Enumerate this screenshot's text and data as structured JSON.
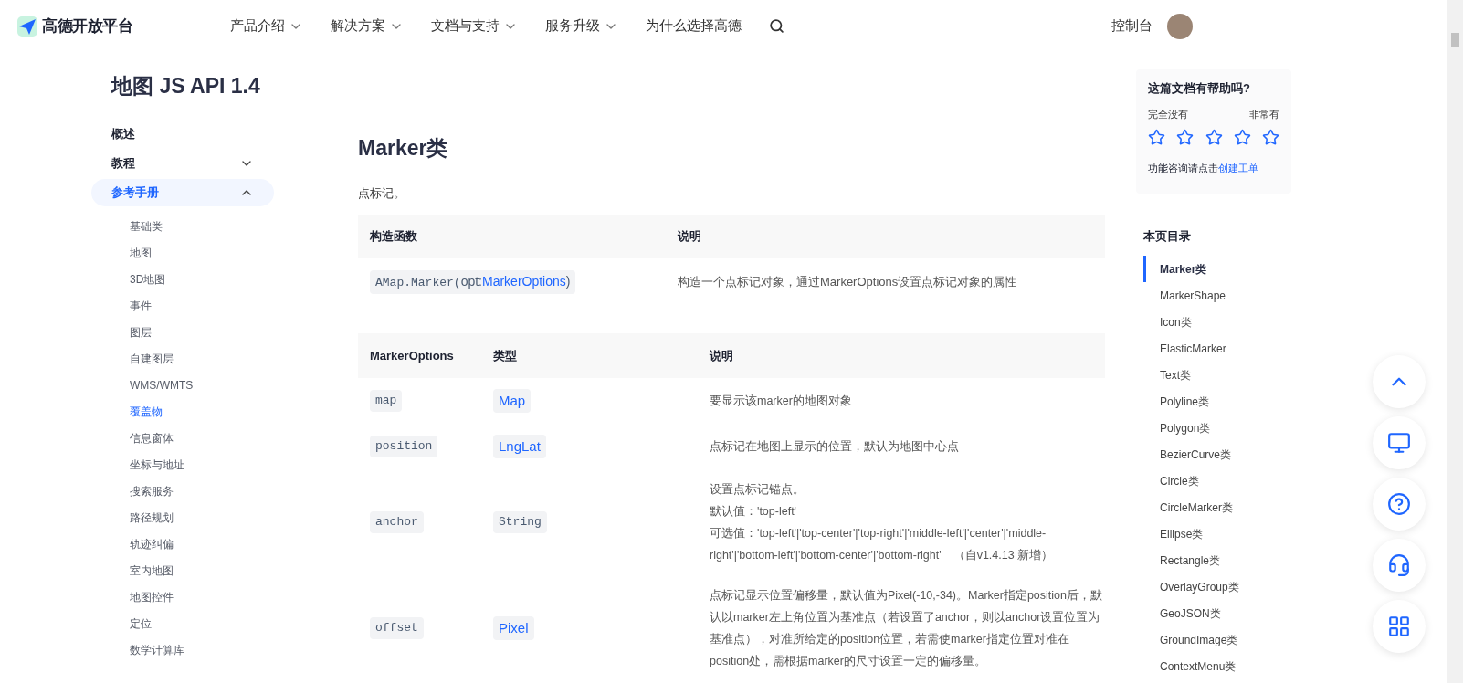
{
  "header": {
    "logo_text": "高德开放平台",
    "nav": [
      {
        "label": "产品介绍",
        "has_dropdown": true
      },
      {
        "label": "解决方案",
        "has_dropdown": true
      },
      {
        "label": "文档与支持",
        "has_dropdown": true
      },
      {
        "label": "服务升级",
        "has_dropdown": true
      },
      {
        "label": "为什么选择高德",
        "has_dropdown": false
      }
    ],
    "console_link": "控制台"
  },
  "sidebar": {
    "title": "地图 JS API 1.4",
    "items": [
      {
        "label": "概述",
        "has_children": false,
        "expanded": false
      },
      {
        "label": "教程",
        "has_children": true,
        "expanded": false
      },
      {
        "label": "参考手册",
        "has_children": true,
        "expanded": true,
        "children": [
          {
            "label": "基础类",
            "selected": false
          },
          {
            "label": "地图",
            "selected": false
          },
          {
            "label": "3D地图",
            "selected": false
          },
          {
            "label": "事件",
            "selected": false
          },
          {
            "label": "图层",
            "selected": false
          },
          {
            "label": "自建图层",
            "selected": false
          },
          {
            "label": "WMS/WMTS",
            "selected": false
          },
          {
            "label": "覆盖物",
            "selected": true
          },
          {
            "label": "信息窗体",
            "selected": false
          },
          {
            "label": "坐标与地址",
            "selected": false
          },
          {
            "label": "搜索服务",
            "selected": false
          },
          {
            "label": "路径规划",
            "selected": false
          },
          {
            "label": "轨迹纠偏",
            "selected": false
          },
          {
            "label": "室内地图",
            "selected": false
          },
          {
            "label": "地图控件",
            "selected": false
          },
          {
            "label": "定位",
            "selected": false
          },
          {
            "label": "数学计算库",
            "selected": false
          }
        ]
      }
    ]
  },
  "content": {
    "heading": "Marker类",
    "intro": "点标记。",
    "constructor_table": {
      "columns": [
        "构造函数",
        "说明"
      ],
      "rows": [
        {
          "signature": [
            {
              "text": "AMap.Marker(",
              "kind": "code"
            },
            {
              "text": "opt:",
              "kind": "plain"
            },
            {
              "text": "MarkerOptions",
              "kind": "link"
            },
            {
              "text": ")",
              "kind": "plain"
            }
          ],
          "description": "构造一个点标记对象，通过MarkerOptions设置点标记对象的属性"
        }
      ]
    },
    "options_table": {
      "columns": [
        "MarkerOptions",
        "类型",
        "说明"
      ],
      "rows": [
        {
          "name": "map",
          "type": {
            "text": "Map",
            "kind": "link"
          },
          "description": [
            "要显示该marker的地图对象"
          ]
        },
        {
          "name": "position",
          "type": {
            "text": "LngLat",
            "kind": "link"
          },
          "description": [
            "点标记在地图上显示的位置，默认为地图中心点"
          ]
        },
        {
          "name": "anchor",
          "type": {
            "text": "String",
            "kind": "code"
          },
          "description": [
            "设置点标记锚点。",
            "默认值：'top-left'",
            "可选值：'top-left'|'top-center'|'top-right'|'middle-left'|'center'|'middle-right'|'bottom-left'|'bottom-center'|'bottom-right'　（自v1.4.13 新增）"
          ]
        },
        {
          "name": "offset",
          "type": {
            "text": "Pixel",
            "kind": "link"
          },
          "description": [
            "点标记显示位置偏移量，默认值为Pixel(-10,-34)。Marker指定position后，默认以marker左上角位置为基准点（若设置了anchor，则以anchor设置位置为基准点），对准所给定的position位置，若需使marker指定位置对准在position处，需根据marker的尺寸设置一定的偏移量。"
          ]
        }
      ]
    }
  },
  "feedback": {
    "title": "这篇文档有帮助吗?",
    "low_label": "完全没有",
    "high_label": "非常有",
    "stars": 0,
    "footer_text": "功能咨询请点击",
    "footer_link": "创建工单"
  },
  "toc": {
    "title": "本页目录",
    "items": [
      {
        "label": "Marker类",
        "selected": true
      },
      {
        "label": "MarkerShape",
        "selected": false
      },
      {
        "label": "Icon类",
        "selected": false
      },
      {
        "label": "ElasticMarker",
        "selected": false
      },
      {
        "label": "Text类",
        "selected": false
      },
      {
        "label": "Polyline类",
        "selected": false
      },
      {
        "label": "Polygon类",
        "selected": false
      },
      {
        "label": "BezierCurve类",
        "selected": false
      },
      {
        "label": "Circle类",
        "selected": false
      },
      {
        "label": "CircleMarker类",
        "selected": false
      },
      {
        "label": "Ellipse类",
        "selected": false
      },
      {
        "label": "Rectangle类",
        "selected": false
      },
      {
        "label": "OverlayGroup类",
        "selected": false
      },
      {
        "label": "GeoJSON类",
        "selected": false
      },
      {
        "label": "GroundImage类",
        "selected": false
      },
      {
        "label": "ContextMenu类",
        "selected": false
      }
    ]
  }
}
